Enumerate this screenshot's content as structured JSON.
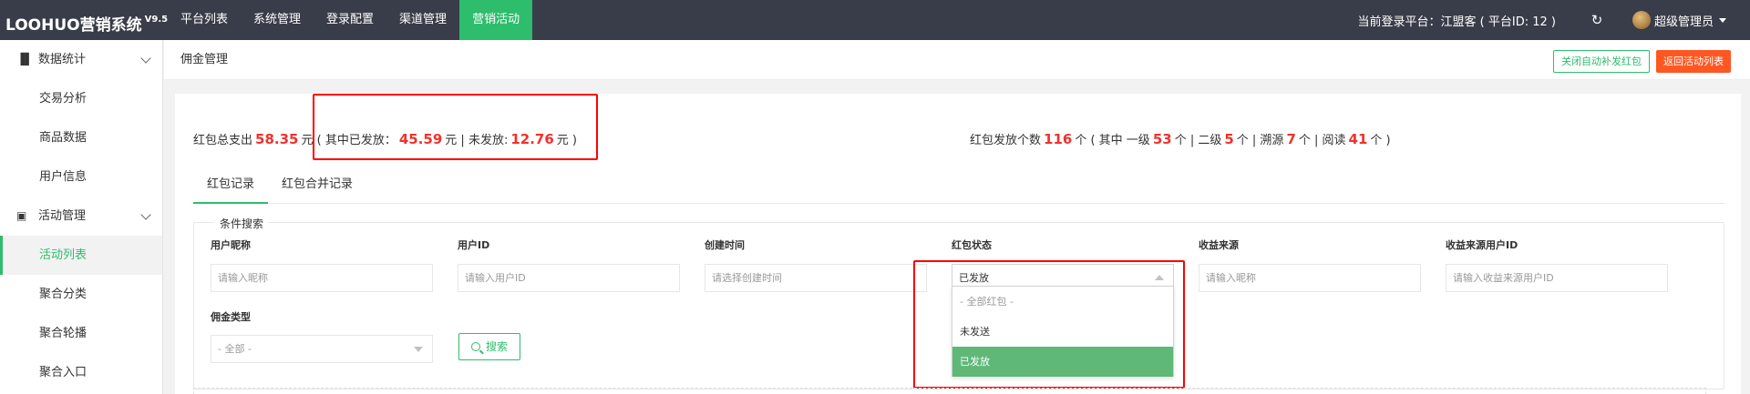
{
  "app": {
    "logo": "LOOHUO营销系统",
    "version": "V9.5"
  },
  "nav": [
    {
      "label": "平台列表"
    },
    {
      "label": "系统管理"
    },
    {
      "label": "登录配置"
    },
    {
      "label": "渠道管理"
    },
    {
      "label": "营销活动",
      "active": true
    }
  ],
  "topright": {
    "platform": "当前登录平台：江盟客 ( 平台ID: 12 )",
    "refresh_icon": "refresh-icon",
    "admin": "超级管理员"
  },
  "sidebar": {
    "groups": [
      {
        "label": "数据统计",
        "icon": "bar-chart-icon",
        "items": [
          {
            "label": "交易分析"
          },
          {
            "label": "商品数据"
          },
          {
            "label": "用户信息"
          }
        ]
      },
      {
        "label": "活动管理",
        "icon": "bag-icon",
        "items": [
          {
            "label": "活动列表",
            "active": true
          },
          {
            "label": "聚合分类"
          },
          {
            "label": "聚合轮播"
          },
          {
            "label": "聚合入口"
          }
        ]
      }
    ]
  },
  "page": {
    "title": "佣金管理",
    "btn_close_auto": "关闭自动补发红包",
    "btn_back": "返回活动列表"
  },
  "stats_left": {
    "label_total": "红包总支出",
    "total": "58.35",
    "unit": "元",
    "open": "( 其中已发放：",
    "issued": "45.59",
    "mid": "元 | 未发放:",
    "unissued": "12.76",
    "close": "元 )"
  },
  "stats_right": {
    "label": "红包发放个数",
    "count": "116",
    "t1": "个 ( 其中 一级",
    "level1": "53",
    "t2": "个 | 二级",
    "level2": "5",
    "t3": "个 | 溯源",
    "trace": "7",
    "t4": "个 | 阅读",
    "read": "41",
    "t5": "个 )"
  },
  "tabs": [
    {
      "label": "红包记录",
      "active": true
    },
    {
      "label": "红包合并记录"
    }
  ],
  "filter": {
    "legend": "条件搜索",
    "fields": {
      "nickname": {
        "label": "用户昵称",
        "placeholder": "请输入昵称"
      },
      "userid": {
        "label": "用户ID",
        "placeholder": "请输入用户ID"
      },
      "created": {
        "label": "创建时间",
        "placeholder": "请选择创建时间"
      },
      "status": {
        "label": "红包状态",
        "value": "已发放"
      },
      "source": {
        "label": "收益来源",
        "placeholder": "请输入昵称"
      },
      "source_uid": {
        "label": "收益来源用户ID",
        "placeholder": "请输入收益来源用户ID"
      },
      "commission_type": {
        "label": "佣金类型",
        "value": "- 全部 -"
      }
    },
    "status_options": [
      {
        "label": "- 全部红包 -"
      },
      {
        "label": "未发送"
      },
      {
        "label": "已发放",
        "selected": true
      }
    ],
    "search_label": "搜索"
  },
  "colors": {
    "topbar": "#393d49",
    "accent": "#2dbd6c",
    "highlight_red": "#ff0000",
    "money_red": "#f0322e",
    "orange": "#ff5722"
  }
}
